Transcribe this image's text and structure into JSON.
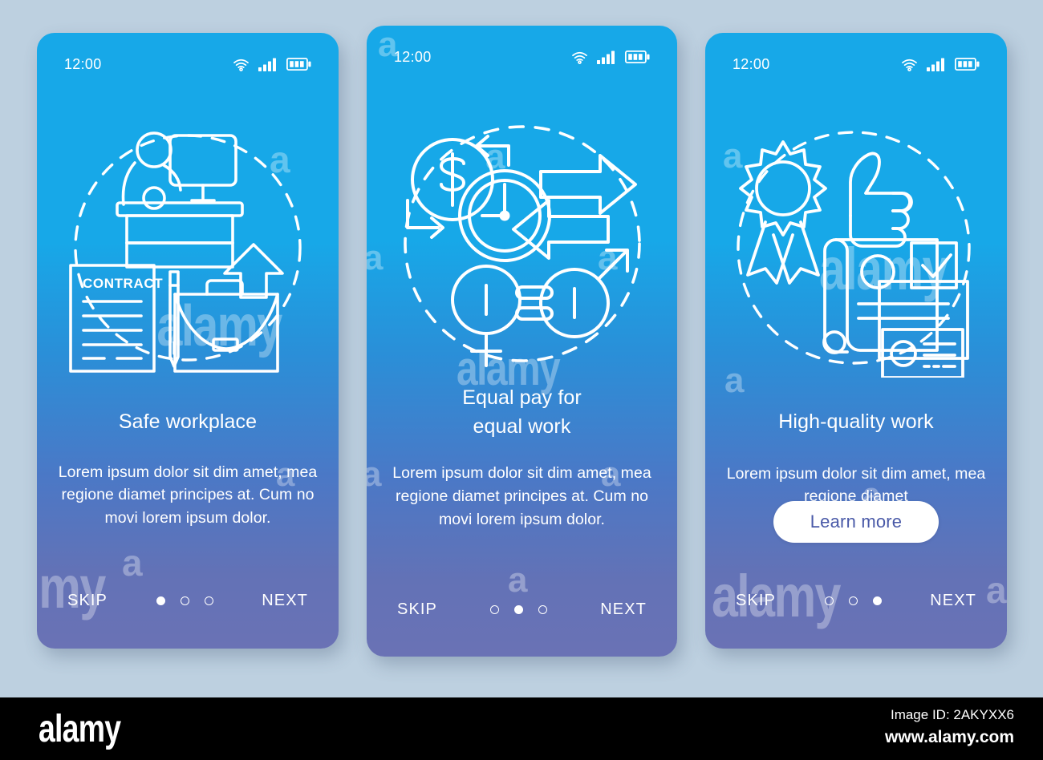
{
  "page": {
    "background_color": "#bdd0e0",
    "watermark_text": "alamy"
  },
  "screens": [
    {
      "id": "safe-workplace",
      "status_bar": {
        "time": "12:00",
        "wifi_icon": "wifi-icon",
        "signal_icon": "signal-bars-icon",
        "battery_icon": "battery-icon"
      },
      "illustration": "workplace-desk-contract-briefcase-illustration",
      "title": "Safe workplace",
      "body": "Lorem ipsum dolor sit dim amet, mea regione diamet principes at. Cum no movi lorem ipsum dolor.",
      "skip_label": "SKIP",
      "next_label": "NEXT",
      "dots": [
        true,
        false,
        false
      ],
      "cta": null
    },
    {
      "id": "equal-pay",
      "status_bar": {
        "time": "12:00",
        "wifi_icon": "wifi-icon",
        "signal_icon": "signal-bars-icon",
        "battery_icon": "battery-icon"
      },
      "illustration": "money-clock-gender-equality-arrows-illustration",
      "title_line1": "Equal pay for",
      "title_line2": "equal work",
      "title": "Equal pay for equal work",
      "body": "Lorem ipsum dolor sit dim amet, mea regione diamet principes at. Cum no movi lorem ipsum dolor.",
      "skip_label": "SKIP",
      "next_label": "NEXT",
      "dots": [
        false,
        true,
        false
      ],
      "cta": null
    },
    {
      "id": "high-quality-work",
      "status_bar": {
        "time": "12:00",
        "wifi_icon": "wifi-icon",
        "signal_icon": "signal-bars-icon",
        "battery_icon": "battery-icon"
      },
      "illustration": "award-thumbsup-certificate-illustration",
      "title": "High-quality work",
      "body": "Lorem ipsum dolor sit dim amet, mea regione diamet",
      "skip_label": "SKIP",
      "next_label": "NEXT",
      "dots": [
        false,
        false,
        true
      ],
      "cta": "Learn more"
    }
  ],
  "colors": {
    "card_top": "#17a8e8",
    "card_bottom": "#6a72b5",
    "cta_text": "#4a5aa8",
    "cta_background": "#ffffff",
    "text": "#ffffff"
  },
  "footer": {
    "logo": "alamy",
    "image_id": "Image ID: 2AKYXX6",
    "site": "www.alamy.com"
  }
}
